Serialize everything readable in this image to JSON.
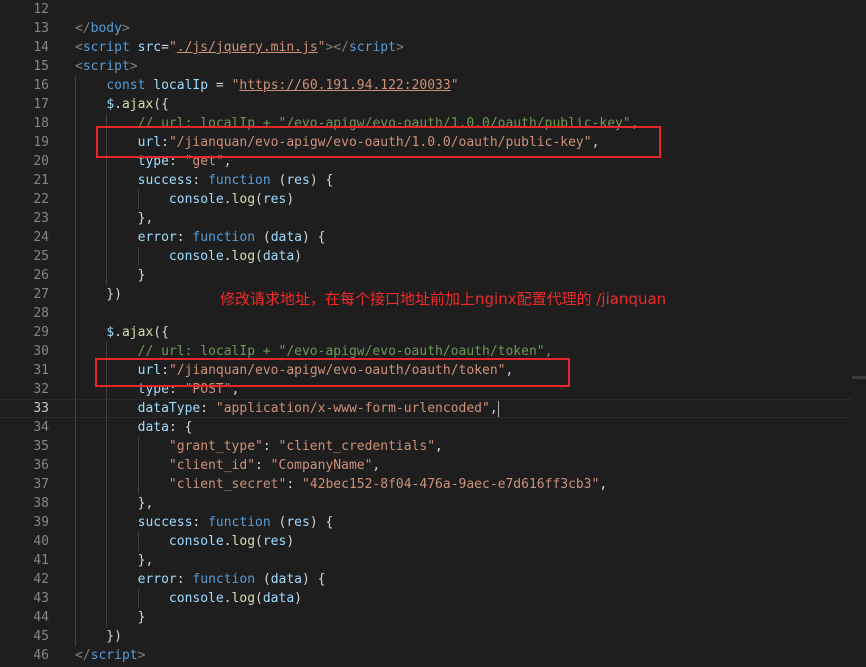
{
  "editor": {
    "language": "html",
    "current_line": 33,
    "annotation": "修改请求地址，在每个接口地址前加上nginx配置代理的 /jianquan",
    "lines": [
      {
        "n": "12",
        "tokens": []
      },
      {
        "n": "13",
        "tokens": [
          {
            "t": "</",
            "c": "tag"
          },
          {
            "t": "body",
            "c": "tagname"
          },
          {
            "t": ">",
            "c": "tag"
          }
        ]
      },
      {
        "n": "14",
        "tokens": [
          {
            "t": "<",
            "c": "tag"
          },
          {
            "t": "script",
            "c": "tagname"
          },
          {
            "t": " ",
            "c": "plain"
          },
          {
            "t": "src",
            "c": "attr"
          },
          {
            "t": "=",
            "c": "plain"
          },
          {
            "t": "\"",
            "c": "str"
          },
          {
            "t": "./js/jquery.min.js",
            "c": "link"
          },
          {
            "t": "\"",
            "c": "str"
          },
          {
            "t": "></",
            "c": "tag"
          },
          {
            "t": "script",
            "c": "tagname"
          },
          {
            "t": ">",
            "c": "tag"
          }
        ]
      },
      {
        "n": "15",
        "tokens": [
          {
            "t": "<",
            "c": "tag"
          },
          {
            "t": "script",
            "c": "tagname"
          },
          {
            "t": ">",
            "c": "tag"
          }
        ]
      },
      {
        "n": "16",
        "tokens": [
          {
            "t": "    ",
            "c": "plain"
          },
          {
            "t": "const",
            "c": "kw"
          },
          {
            "t": " ",
            "c": "plain"
          },
          {
            "t": "localIp",
            "c": "var"
          },
          {
            "t": " = ",
            "c": "plain"
          },
          {
            "t": "\"",
            "c": "str"
          },
          {
            "t": "https://60.191.94.122:20033",
            "c": "link"
          },
          {
            "t": "\"",
            "c": "str"
          }
        ]
      },
      {
        "n": "17",
        "tokens": [
          {
            "t": "    ",
            "c": "plain"
          },
          {
            "t": "$",
            "c": "var"
          },
          {
            "t": ".",
            "c": "plain"
          },
          {
            "t": "ajax",
            "c": "func"
          },
          {
            "t": "({",
            "c": "plain"
          }
        ]
      },
      {
        "n": "18",
        "tokens": [
          {
            "t": "        ",
            "c": "plain"
          },
          {
            "t": "// url: localIp + \"/evo-apigw/evo-oauth/1.0.0/oauth/public-key\",",
            "c": "comment"
          }
        ]
      },
      {
        "n": "19",
        "tokens": [
          {
            "t": "        ",
            "c": "plain"
          },
          {
            "t": "url",
            "c": "objkey"
          },
          {
            "t": ":",
            "c": "plain"
          },
          {
            "t": "\"/jianquan/evo-apigw/evo-oauth/1.0.0/oauth/public-key\"",
            "c": "str"
          },
          {
            "t": ",",
            "c": "plain"
          }
        ]
      },
      {
        "n": "20",
        "tokens": [
          {
            "t": "        ",
            "c": "plain"
          },
          {
            "t": "type",
            "c": "objkey"
          },
          {
            "t": ": ",
            "c": "plain"
          },
          {
            "t": "\"get\"",
            "c": "str"
          },
          {
            "t": ",",
            "c": "plain"
          }
        ]
      },
      {
        "n": "21",
        "tokens": [
          {
            "t": "        ",
            "c": "plain"
          },
          {
            "t": "success",
            "c": "objkey"
          },
          {
            "t": ": ",
            "c": "plain"
          },
          {
            "t": "function",
            "c": "kw"
          },
          {
            "t": " (",
            "c": "plain"
          },
          {
            "t": "res",
            "c": "var"
          },
          {
            "t": ") {",
            "c": "plain"
          }
        ]
      },
      {
        "n": "22",
        "tokens": [
          {
            "t": "            ",
            "c": "plain"
          },
          {
            "t": "console",
            "c": "var"
          },
          {
            "t": ".",
            "c": "plain"
          },
          {
            "t": "log",
            "c": "func"
          },
          {
            "t": "(",
            "c": "plain"
          },
          {
            "t": "res",
            "c": "var"
          },
          {
            "t": ")",
            "c": "plain"
          }
        ]
      },
      {
        "n": "23",
        "tokens": [
          {
            "t": "        },",
            "c": "plain"
          }
        ]
      },
      {
        "n": "24",
        "tokens": [
          {
            "t": "        ",
            "c": "plain"
          },
          {
            "t": "error",
            "c": "objkey"
          },
          {
            "t": ": ",
            "c": "plain"
          },
          {
            "t": "function",
            "c": "kw"
          },
          {
            "t": " (",
            "c": "plain"
          },
          {
            "t": "data",
            "c": "var"
          },
          {
            "t": ") {",
            "c": "plain"
          }
        ]
      },
      {
        "n": "25",
        "tokens": [
          {
            "t": "            ",
            "c": "plain"
          },
          {
            "t": "console",
            "c": "var"
          },
          {
            "t": ".",
            "c": "plain"
          },
          {
            "t": "log",
            "c": "func"
          },
          {
            "t": "(",
            "c": "plain"
          },
          {
            "t": "data",
            "c": "var"
          },
          {
            "t": ")",
            "c": "plain"
          }
        ]
      },
      {
        "n": "26",
        "tokens": [
          {
            "t": "        }",
            "c": "plain"
          }
        ]
      },
      {
        "n": "27",
        "tokens": [
          {
            "t": "    })",
            "c": "plain"
          }
        ]
      },
      {
        "n": "28",
        "tokens": []
      },
      {
        "n": "29",
        "tokens": [
          {
            "t": "    ",
            "c": "plain"
          },
          {
            "t": "$",
            "c": "var"
          },
          {
            "t": ".",
            "c": "plain"
          },
          {
            "t": "ajax",
            "c": "func"
          },
          {
            "t": "({",
            "c": "plain"
          }
        ]
      },
      {
        "n": "30",
        "tokens": [
          {
            "t": "        ",
            "c": "plain"
          },
          {
            "t": "// url: localIp + \"/evo-apigw/evo-oauth/oauth/token\",",
            "c": "comment"
          }
        ]
      },
      {
        "n": "31",
        "tokens": [
          {
            "t": "        ",
            "c": "plain"
          },
          {
            "t": "url",
            "c": "objkey"
          },
          {
            "t": ":",
            "c": "plain"
          },
          {
            "t": "\"/jianquan/evo-apigw/evo-oauth/oauth/token\"",
            "c": "str"
          },
          {
            "t": ",",
            "c": "plain"
          }
        ]
      },
      {
        "n": "32",
        "tokens": [
          {
            "t": "        ",
            "c": "plain"
          },
          {
            "t": "type",
            "c": "objkey"
          },
          {
            "t": ": ",
            "c": "plain"
          },
          {
            "t": "\"POST\"",
            "c": "str"
          },
          {
            "t": ",",
            "c": "plain"
          }
        ]
      },
      {
        "n": "33",
        "tokens": [
          {
            "t": "        ",
            "c": "plain"
          },
          {
            "t": "dataType",
            "c": "objkey"
          },
          {
            "t": ": ",
            "c": "plain"
          },
          {
            "t": "\"application/x-www-form-urlencoded\"",
            "c": "str"
          },
          {
            "t": ",",
            "c": "plain"
          }
        ]
      },
      {
        "n": "34",
        "tokens": [
          {
            "t": "        ",
            "c": "plain"
          },
          {
            "t": "data",
            "c": "objkey"
          },
          {
            "t": ": {",
            "c": "plain"
          }
        ]
      },
      {
        "n": "35",
        "tokens": [
          {
            "t": "            ",
            "c": "plain"
          },
          {
            "t": "\"grant_type\"",
            "c": "str"
          },
          {
            "t": ": ",
            "c": "plain"
          },
          {
            "t": "\"client_credentials\"",
            "c": "str"
          },
          {
            "t": ",",
            "c": "plain"
          }
        ]
      },
      {
        "n": "36",
        "tokens": [
          {
            "t": "            ",
            "c": "plain"
          },
          {
            "t": "\"client_id\"",
            "c": "str"
          },
          {
            "t": ": ",
            "c": "plain"
          },
          {
            "t": "\"CompanyName\"",
            "c": "str"
          },
          {
            "t": ",",
            "c": "plain"
          }
        ]
      },
      {
        "n": "37",
        "tokens": [
          {
            "t": "            ",
            "c": "plain"
          },
          {
            "t": "\"client_secret\"",
            "c": "str"
          },
          {
            "t": ": ",
            "c": "plain"
          },
          {
            "t": "\"42bec152-8f04-476a-9aec-e7d616ff3cb3\"",
            "c": "str"
          },
          {
            "t": ",",
            "c": "plain"
          }
        ]
      },
      {
        "n": "38",
        "tokens": [
          {
            "t": "        },",
            "c": "plain"
          }
        ]
      },
      {
        "n": "39",
        "tokens": [
          {
            "t": "        ",
            "c": "plain"
          },
          {
            "t": "success",
            "c": "objkey"
          },
          {
            "t": ": ",
            "c": "plain"
          },
          {
            "t": "function",
            "c": "kw"
          },
          {
            "t": " (",
            "c": "plain"
          },
          {
            "t": "res",
            "c": "var"
          },
          {
            "t": ") {",
            "c": "plain"
          }
        ]
      },
      {
        "n": "40",
        "tokens": [
          {
            "t": "            ",
            "c": "plain"
          },
          {
            "t": "console",
            "c": "var"
          },
          {
            "t": ".",
            "c": "plain"
          },
          {
            "t": "log",
            "c": "func"
          },
          {
            "t": "(",
            "c": "plain"
          },
          {
            "t": "res",
            "c": "var"
          },
          {
            "t": ")",
            "c": "plain"
          }
        ]
      },
      {
        "n": "41",
        "tokens": [
          {
            "t": "        },",
            "c": "plain"
          }
        ]
      },
      {
        "n": "42",
        "tokens": [
          {
            "t": "        ",
            "c": "plain"
          },
          {
            "t": "error",
            "c": "objkey"
          },
          {
            "t": ": ",
            "c": "plain"
          },
          {
            "t": "function",
            "c": "kw"
          },
          {
            "t": " (",
            "c": "plain"
          },
          {
            "t": "data",
            "c": "var"
          },
          {
            "t": ") {",
            "c": "plain"
          }
        ]
      },
      {
        "n": "43",
        "tokens": [
          {
            "t": "            ",
            "c": "plain"
          },
          {
            "t": "console",
            "c": "var"
          },
          {
            "t": ".",
            "c": "plain"
          },
          {
            "t": "log",
            "c": "func"
          },
          {
            "t": "(",
            "c": "plain"
          },
          {
            "t": "data",
            "c": "var"
          },
          {
            "t": ")",
            "c": "plain"
          }
        ]
      },
      {
        "n": "44",
        "tokens": [
          {
            "t": "        }",
            "c": "plain"
          }
        ]
      },
      {
        "n": "45",
        "tokens": [
          {
            "t": "    })",
            "c": "plain"
          }
        ]
      },
      {
        "n": "46",
        "tokens": [
          {
            "t": "</",
            "c": "tag"
          },
          {
            "t": "script",
            "c": "tagname"
          },
          {
            "t": ">",
            "c": "tag"
          }
        ]
      }
    ]
  }
}
